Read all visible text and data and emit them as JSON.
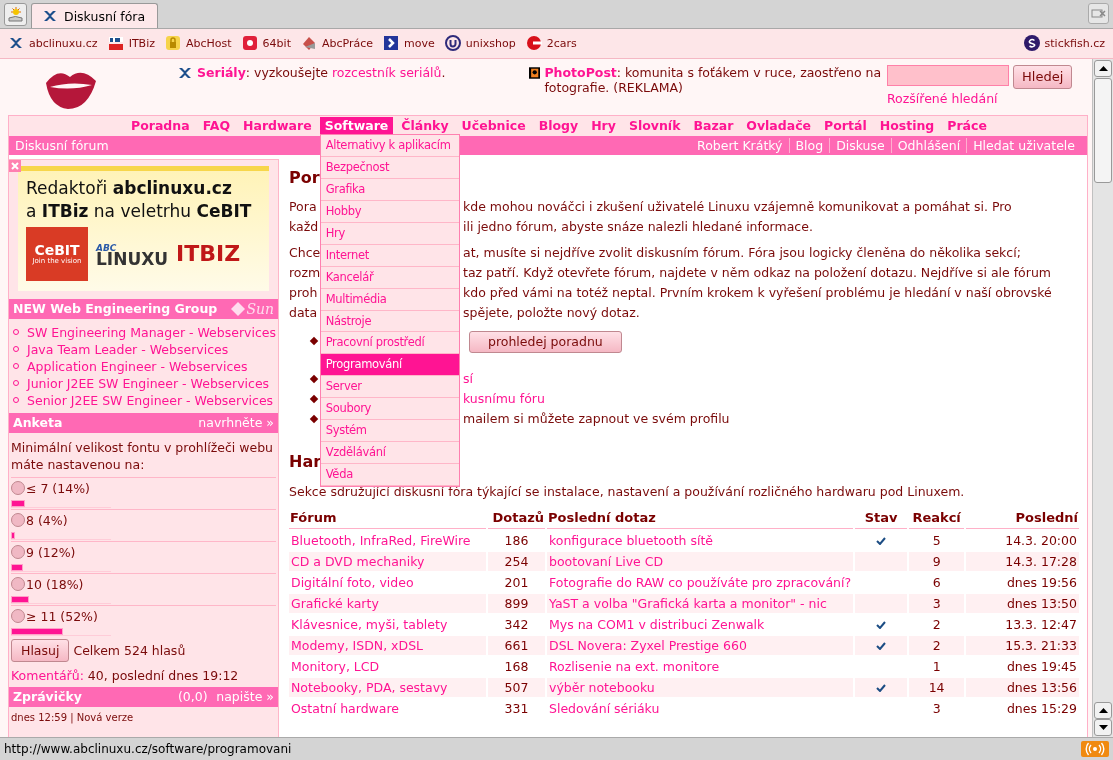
{
  "browser": {
    "tabs": [
      {
        "label": "Diskusní fóra",
        "selected": true
      }
    ],
    "bookmarks": [
      "abclinuxu.cz",
      "ITBiz",
      "AbcHost",
      "64bit",
      "AbcPráce",
      "move",
      "unixshop",
      "2cars"
    ],
    "bookmark_right": "stickfish.cz",
    "status_url": "http://www.abclinuxu.cz/software/programovani"
  },
  "header": {
    "promo": {
      "title": "Seriály",
      "text_before": ": vyzkoušejte ",
      "link": "rozcestník seriálů",
      "text_after": "."
    },
    "ad": {
      "title": "PhotoPost",
      "text": ": komunita s foťákem v ruce, zaostřeno na fotografie. (REKLAMA)"
    },
    "search": {
      "button": "Hledej",
      "advanced_link": "Rozšířené hledání"
    }
  },
  "nav": {
    "items": [
      {
        "label": "Poradna",
        "selected": false
      },
      {
        "label": "FAQ",
        "selected": false
      },
      {
        "label": "Hardware",
        "selected": false
      },
      {
        "label": "Software",
        "selected": true
      },
      {
        "label": "Články",
        "selected": false
      },
      {
        "label": "Učebnice",
        "selected": false
      },
      {
        "label": "Blogy",
        "selected": false
      },
      {
        "label": "Hry",
        "selected": false
      },
      {
        "label": "Slovník",
        "selected": false
      },
      {
        "label": "Bazar",
        "selected": false
      },
      {
        "label": "Ovladače",
        "selected": false
      },
      {
        "label": "Portál",
        "selected": false
      },
      {
        "label": "Hosting",
        "selected": false
      },
      {
        "label": "Práce",
        "selected": false
      }
    ],
    "section": "Diskusní fórum",
    "user_links": [
      "Robert Krátký",
      "Blog",
      "Diskuse",
      "Odhlášení",
      "Hledat uživatele"
    ]
  },
  "menu": {
    "items": [
      {
        "label": "Alternativy k aplikacím",
        "selected": false
      },
      {
        "label": "Bezpečnost",
        "selected": false
      },
      {
        "label": "Grafika",
        "selected": false
      },
      {
        "label": "Hobby",
        "selected": false
      },
      {
        "label": "Hry",
        "selected": false
      },
      {
        "label": "Internet",
        "selected": false
      },
      {
        "label": "Kancelář",
        "selected": false
      },
      {
        "label": "Multimédia",
        "selected": false
      },
      {
        "label": "Nástroje",
        "selected": false
      },
      {
        "label": "Pracovní prostředí",
        "selected": false
      },
      {
        "label": "Programování",
        "selected": true
      },
      {
        "label": "Server",
        "selected": false
      },
      {
        "label": "Soubory",
        "selected": false
      },
      {
        "label": "Systém",
        "selected": false
      },
      {
        "label": "Vzdělávání",
        "selected": false
      },
      {
        "label": "Věda",
        "selected": false
      }
    ]
  },
  "sidebar": {
    "banner": {
      "headline": [
        "Redaktoři **abclinuxu.cz**",
        "a **ITBiz** na veletrhu **CeBIT**"
      ],
      "logos": [
        "CeBIT",
        "Join the vision",
        "ABC",
        "LINUXU",
        "ITBIZ"
      ]
    },
    "jobs": {
      "title": "NEW Web Engineering Group",
      "sponsor": "Sun",
      "items": [
        "SW Engineering Manager - Webservices",
        "Java Team Leader - Webservices",
        "Application Engineer - Webservices",
        "Junior J2EE SW Engineer - Webservices",
        "Senior J2EE SW Engineer - Webservices"
      ]
    },
    "poll": {
      "title": "Anketa",
      "action": "navrhněte »",
      "question": "Minimální velikost fontu v prohlížeči webu máte nastavenou na:",
      "options": [
        {
          "label": "≤ 7 (14%)",
          "level": 0.14,
          "selected": false
        },
        {
          "label": "8 (4%)",
          "level": 0.04,
          "selected": false
        },
        {
          "label": "9 (12%)",
          "level": 0.12,
          "selected": false
        },
        {
          "label": "10 (18%)",
          "level": 0.18,
          "selected": false
        },
        {
          "label": "≥ 11 (52%)",
          "level": 0.52,
          "selected": false
        }
      ],
      "button": "Hlasuj",
      "total": "Celkem 524 hlasů",
      "comments_link": "Komentářů:",
      "comments_text": "40, poslední dnes 19:12"
    },
    "news": {
      "title": "Zprávičky",
      "count": "(0,0)",
      "action": "napište »",
      "items": [
        "dnes 12:59 | Nová verze"
      ]
    }
  },
  "content": {
    "heading": "Por",
    "paragraphs": [
      [
        {
          "left": "Pora",
          "right": "kde mohou nováčci i zkušení uživatelé Linuxu vzájemně komunikovat a pomáhat si. Pro"
        },
        {
          "left": "každ",
          "right": "ili jedno fórum, abyste snáze nalezli hledané informace."
        }
      ],
      [
        {
          "left": "Chce",
          "right": "at, musíte si nejdříve zvolit diskusním fórum. Fóra jsou logicky členěna do několika sekcí;"
        },
        {
          "left": "rozm",
          "right": "taz patří. Když otevřete fórum, najdete v něm odkaz na položení dotazu. Nejdříve si ale fórum"
        },
        {
          "left": "proh",
          "right": "kdo před vámi na totéž neptal. Prvním krokem k vyřešení problému je hledání v naší obrovské"
        },
        {
          "left": "data",
          "right": "spějete, položte nový dotaz."
        }
      ]
    ],
    "bullets": [
      {
        "kind": "search",
        "button": "prohledej poradnu"
      },
      {
        "kind": "link",
        "text": "sí"
      },
      {
        "kind": "link",
        "text": "kusnímu fóru"
      },
      {
        "kind": "text",
        "text": "mailem si můžete zapnout ve svém profilu"
      }
    ],
    "hardware": {
      "heading": "Har",
      "description": "Sekce sdružující diskusní fóra týkající se instalace, nastavení a používání rozličného hardwaru pod Linuxem.",
      "table": {
        "columns": [
          "Fórum",
          "Dotazů",
          "Poslední dotaz",
          "Stav",
          "Reakcí",
          "Poslední"
        ],
        "rows": [
          {
            "forum": "Bluetooth, InfraRed, FireWire",
            "count": "186",
            "question": "konfigurace bluetooth sítě",
            "solved": true,
            "replies": "5",
            "last": "14.3. 20:00"
          },
          {
            "forum": "CD a DVD mechaniky",
            "count": "254",
            "question": "bootovaní Live CD",
            "solved": false,
            "replies": "9",
            "last": "14.3. 17:28"
          },
          {
            "forum": "Digitální foto, video",
            "count": "201",
            "question": "Fotografie do RAW co používáte pro zpracování?",
            "solved": false,
            "replies": "6",
            "last": "dnes 19:56"
          },
          {
            "forum": "Grafické karty",
            "count": "899",
            "question": "YaST a volba \"Grafická karta a monitor\" - nic",
            "solved": false,
            "replies": "3",
            "last": "dnes 13:50"
          },
          {
            "forum": "Klávesnice, myši, tablety",
            "count": "342",
            "question": "Mys na COM1 v distribuci Zenwalk",
            "solved": true,
            "replies": "2",
            "last": "13.3. 12:47"
          },
          {
            "forum": "Modemy, ISDN, xDSL",
            "count": "661",
            "question": "DSL Novera: Zyxel Prestige 660",
            "solved": true,
            "replies": "2",
            "last": "15.3. 21:33"
          },
          {
            "forum": "Monitory, LCD",
            "count": "168",
            "question": "Rozlisenie na ext. monitore",
            "solved": false,
            "replies": "1",
            "last": "dnes 19:45"
          },
          {
            "forum": "Notebooky, PDA, sestavy",
            "count": "507",
            "question": "výběr notebooku",
            "solved": true,
            "replies": "14",
            "last": "dnes 13:56"
          },
          {
            "forum": "Ostatní hardware",
            "count": "331",
            "question": "Sledování sériáku",
            "solved": false,
            "replies": "3",
            "last": "dnes 15:29"
          }
        ]
      }
    }
  }
}
